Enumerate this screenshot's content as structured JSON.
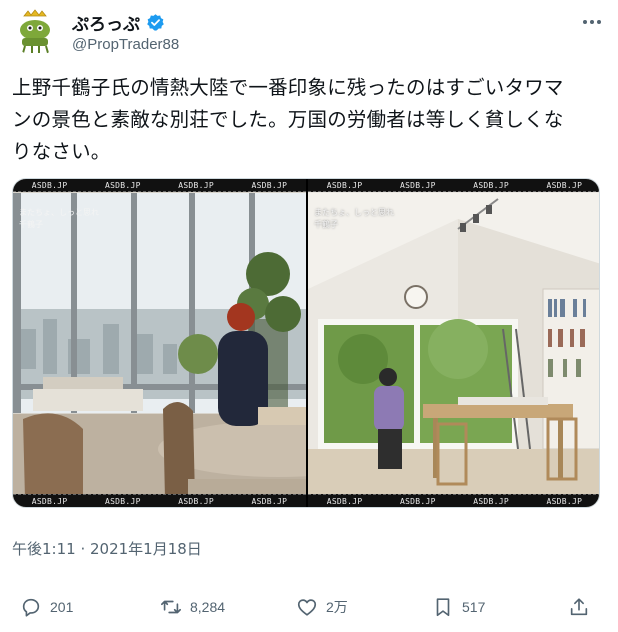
{
  "author": {
    "display_name": "ぷろっぷ",
    "handle": "@PropTrader88",
    "avatar_icon": "crowned-bug-avatar",
    "verified_icon": "verified-badge-icon",
    "verified_color": "#1d9bf0"
  },
  "menu_icon": "more-options-icon",
  "tweet": {
    "text_line1": "上野千鶴子氏の情熱大陸で一番印象に残ったのはすごいタワマ",
    "text_line2": "ンの景色と素敵な別荘でした。万国の労働者は等しく貧しくな",
    "text_line3": "りなさい。"
  },
  "media": {
    "watermark": "ASDB.JP",
    "left_caption": "またちょ、しっと思れ",
    "left_caption2": "千鶴子",
    "right_caption": "またちょ、しっと思れ",
    "right_caption2": "千鶴子"
  },
  "timestamp": "午後1:11 · 2021年1月18日",
  "actions": {
    "replies": "201",
    "retweets": "8,284",
    "likes": "2万",
    "bookmarks": "517"
  },
  "colors": {
    "text_primary": "#0f1419",
    "text_secondary": "#536471",
    "border": "#cfd9de"
  }
}
